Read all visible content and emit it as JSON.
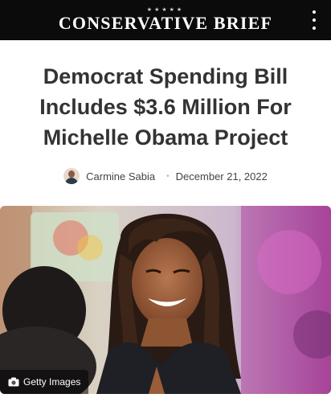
{
  "header": {
    "stars": "★★★★★",
    "site_name": "CONSERVATIVE BRIEF",
    "menu_icon": "vertical-dots-icon"
  },
  "article": {
    "headline": "Democrat Spending Bill Includes $3.6 Million For Michelle Obama Project",
    "author": "Carmine Sabia",
    "separator": "•",
    "date": "December 21, 2022"
  },
  "photo": {
    "credit_icon": "camera-icon",
    "credit": "Getty Images"
  },
  "colors": {
    "topbar": "#0b0b0b",
    "headline": "#333333",
    "credit_bg": "rgba(0,0,0,0.55)"
  }
}
